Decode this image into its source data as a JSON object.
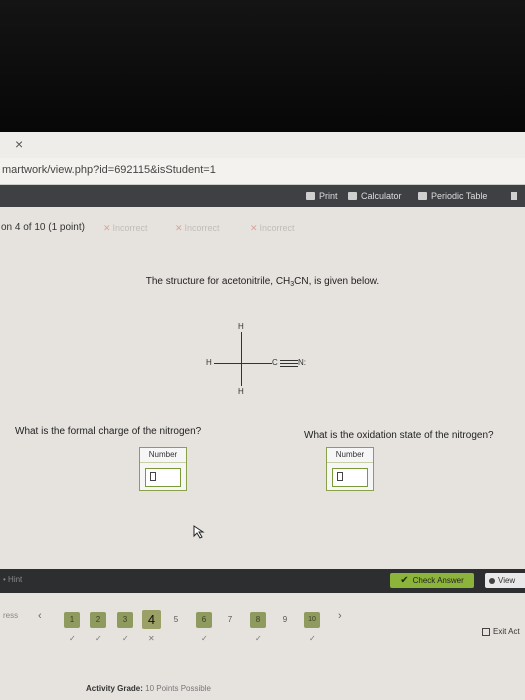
{
  "browser": {
    "close_glyph": "×",
    "url": "martwork/view.php?id=692115&isStudent=1"
  },
  "toolbar": {
    "print": "Print",
    "calculator": "Calculator",
    "periodic_table": "Periodic Table"
  },
  "question": {
    "number_label": "on 4 of 10 (1 point)",
    "attempts": [
      "Incorrect",
      "Incorrect",
      "Incorrect"
    ],
    "intro_before": "The structure for acetonitrile, CH",
    "intro_sub": "3",
    "intro_after": "CN, is given below."
  },
  "molecule": {
    "h_top": "H",
    "h_left": "H",
    "c_center": "C",
    "n_right": "N:",
    "h_bottom": "H"
  },
  "parts": [
    {
      "prompt": "What is the formal charge of the nitrogen?",
      "box_label": "Number"
    },
    {
      "prompt": "What is the oxidation state of the nitrogen?",
      "box_label": "Number"
    }
  ],
  "footer": {
    "hint": "Hint",
    "check_answer": "Check Answer",
    "view": "View",
    "previous": "ress",
    "prev_arrow": "‹",
    "next_arrow": "›",
    "questions": [
      "1",
      "2",
      "3",
      "4",
      "5",
      "6",
      "7",
      "8",
      "9",
      "10"
    ],
    "exit": "Exit Act",
    "grade_label": "Activity Grade:",
    "grade_value": "10 Points Possible"
  }
}
